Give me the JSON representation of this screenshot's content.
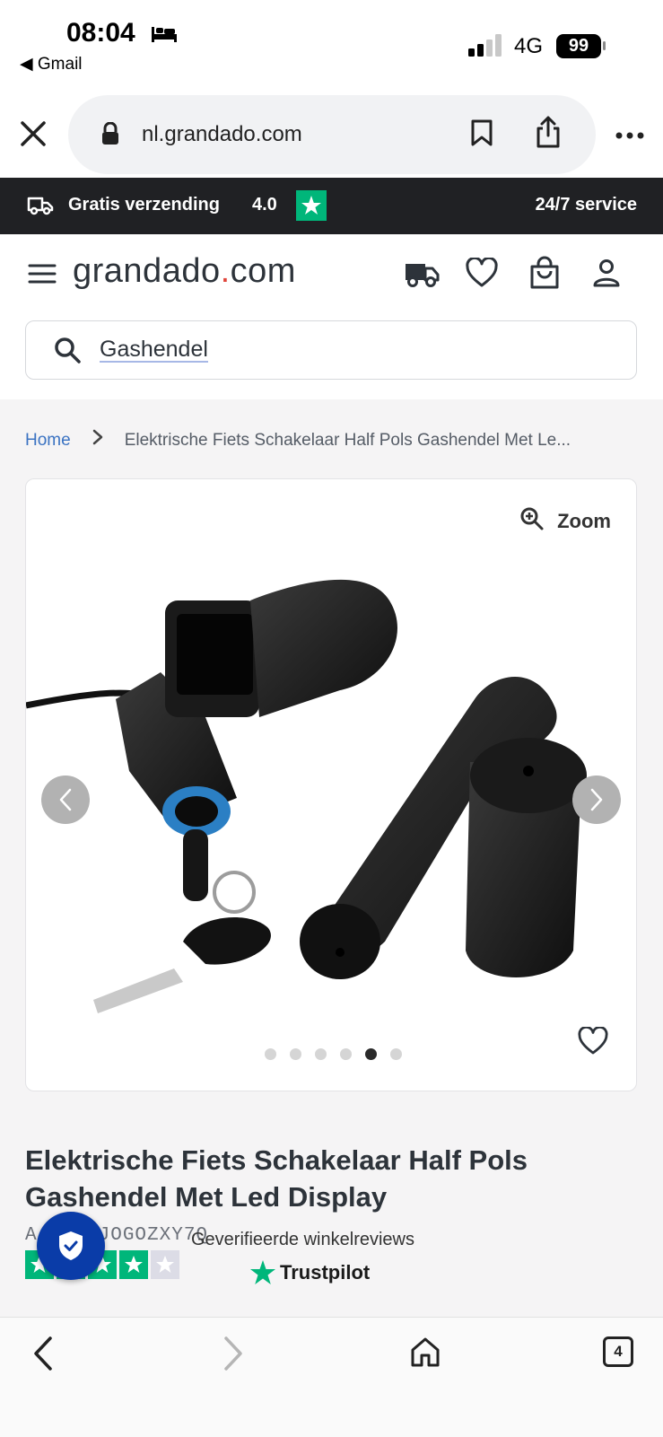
{
  "status_bar": {
    "time": "08:04",
    "back_app": "◀ Gmail",
    "network": "4G",
    "battery": "99"
  },
  "browser": {
    "url": "nl.grandado.com",
    "close_icon": "close-icon",
    "bookmark_icon": "bookmark-icon",
    "share_icon": "share-icon"
  },
  "promo": {
    "shipping": "Gratis verzending",
    "rating": "4.0",
    "service": "24/7 service"
  },
  "header": {
    "logo_main": "grandado",
    "logo_dot": ".",
    "logo_tld": "com",
    "search_value": "Gashendel"
  },
  "breadcrumb": {
    "home": "Home",
    "current": "Elektrische Fiets Schakelaar Half Pols Gashendel Met Le..."
  },
  "gallery": {
    "zoom_label": "Zoom",
    "slide_count": 6,
    "active_slide": 5
  },
  "product": {
    "title": "Elektrische Fiets Schakelaar Half Pols Gashendel Met Led Display",
    "sku": "A        C-W5JOGOZXY7Q",
    "stars": 4,
    "stars_max": 5,
    "reviews_label": "Geverifieerde winkelreviews",
    "trustpilot": "Trustpilot"
  },
  "toolbar": {
    "tabs_count": "4"
  },
  "colors": {
    "promo_bg": "#202124",
    "trustpilot_green": "#00b67a",
    "shield_blue": "#0a3ca8",
    "link_blue": "#3b73c2",
    "logo_dot": "#e0443a"
  }
}
